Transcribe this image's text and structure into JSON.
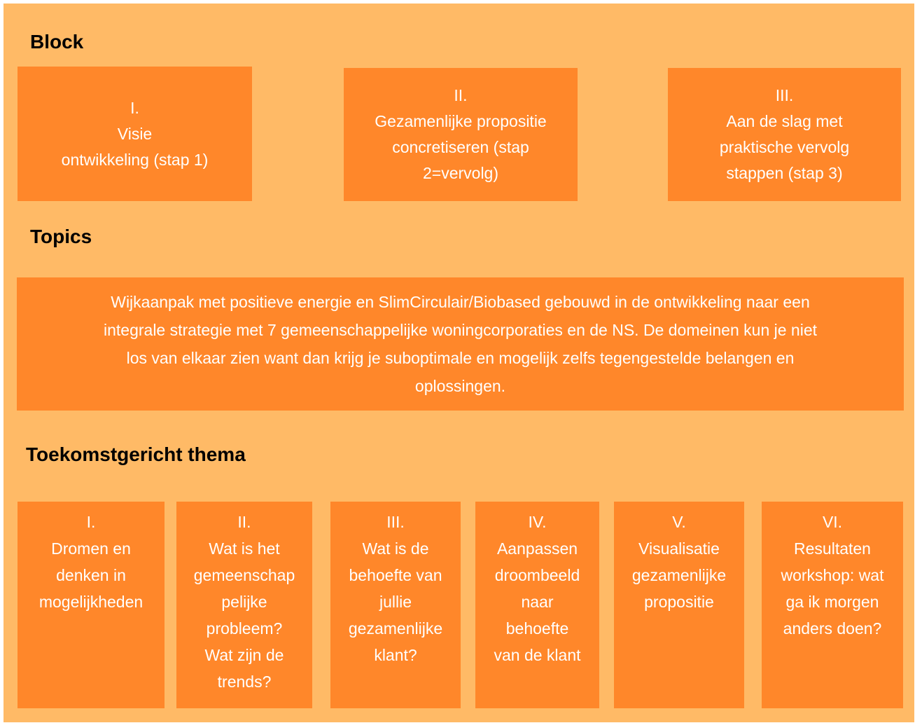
{
  "sections": {
    "block_title": "Block",
    "topics_title": "Topics",
    "theme_title": "Toekomstgericht thema"
  },
  "blocks": [
    {
      "lines": [
        "I.",
        "Visie",
        "ontwikkeling (stap 1)"
      ]
    },
    {
      "lines": [
        "II.",
        "Gezamenlijke propositie",
        "concretiseren (stap",
        "2=vervolg)"
      ]
    },
    {
      "lines": [
        "III.",
        "Aan de slag met",
        "praktische vervolg",
        "stappen (stap 3)"
      ]
    }
  ],
  "topic": {
    "lines": [
      "Wijkaanpak met positieve energie en SlimCirculair/Biobased gebouwd in de ontwikkeling naar een",
      "integrale strategie met 7 gemeenschappelijke woningcorporaties en de NS. De domeinen kun je niet",
      "los van elkaar zien want dan krijg je suboptimale en mogelijk zelfs tegengestelde belangen en",
      "oplossingen."
    ]
  },
  "themes": [
    {
      "lines": [
        "I.",
        "Dromen en",
        "denken in",
        "mogelijkheden"
      ]
    },
    {
      "lines": [
        "II.",
        "Wat is het",
        "gemeenschap",
        "pelijke",
        "probleem?",
        "Wat zijn de",
        "trends?"
      ]
    },
    {
      "lines": [
        "III.",
        "Wat is de",
        "behoefte van",
        "jullie",
        "gezamenlijke",
        "klant?"
      ]
    },
    {
      "lines": [
        "IV.",
        "Aanpassen",
        "droombeeld",
        "naar",
        "behoefte",
        "van de klant"
      ]
    },
    {
      "lines": [
        "V.",
        "Visualisatie",
        "gezamenlijke",
        "propositie"
      ]
    },
    {
      "lines": [
        "VI.",
        "Resultaten",
        "workshop: wat",
        "ga ik morgen",
        "anders doen?"
      ]
    }
  ],
  "colors": {
    "background": "#FFBA66",
    "box": "#FF872A",
    "box_text": "#FFFFFF",
    "heading_text": "#000000"
  }
}
